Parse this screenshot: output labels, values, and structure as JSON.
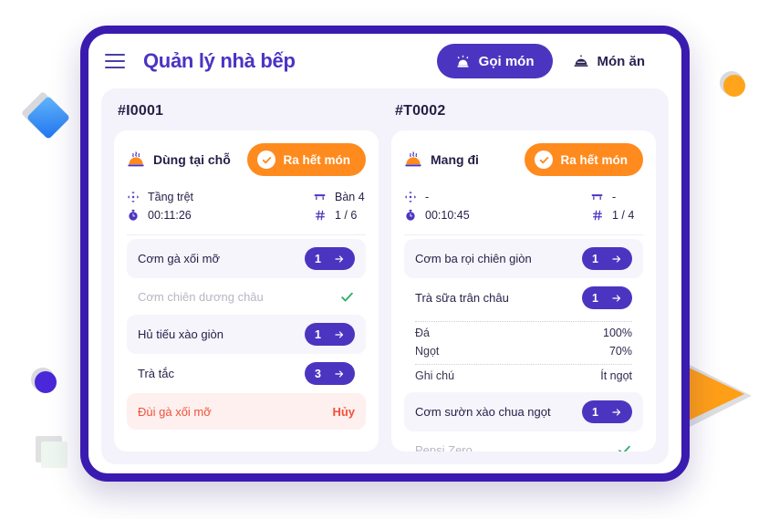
{
  "app": {
    "title": "Quản lý nhà bếp",
    "menu_icon": "hamburger-menu-icon",
    "accent_purple": "#4b35c0",
    "accent_orange": "#ff8a1e",
    "frame_border": "#3a1bb0",
    "panel_bg": "#f4f3fb",
    "danger": "#f1513b",
    "success": "#2fae6a"
  },
  "tabs": [
    {
      "label": "Gọi món",
      "icon": "bell-alarm-icon",
      "active": true
    },
    {
      "label": "Món ăn",
      "icon": "food-cloche-icon",
      "active": false
    }
  ],
  "orders": [
    {
      "code": "#I0001",
      "type_label": "Dùng tại chỗ",
      "type_icon": "dish-steam-icon",
      "done_button": "Ra hết món",
      "done_icon": "check-circle-icon",
      "floor_icon": "floor-move-icon",
      "floor": "Tầng trệt",
      "table_icon": "table-icon",
      "table": "Bàn 4",
      "timer_icon": "stopwatch-icon",
      "timer": "00:11:26",
      "count_icon": "hash-icon",
      "count": "1 / 6",
      "items": [
        {
          "name": "Cơm gà xối mỡ",
          "qty": "1",
          "state": "pending",
          "tinted": true
        },
        {
          "name": "Cơm chiên dương châu",
          "state": "served",
          "tinted": false
        },
        {
          "name": "Hủ tiếu xào giòn",
          "qty": "1",
          "state": "pending",
          "tinted": true
        },
        {
          "name": "Trà tắc",
          "qty": "3",
          "state": "pending",
          "tinted": false
        },
        {
          "name": "Đùi gà xối mỡ",
          "state": "cancelled",
          "cancel_label": "Hủy",
          "tinted": false
        }
      ]
    },
    {
      "code": "#T0002",
      "type_label": "Mang đi",
      "type_icon": "dish-steam-icon",
      "done_button": "Ra hết món",
      "done_icon": "check-circle-icon",
      "floor_icon": "floor-move-icon",
      "floor": "-",
      "table_icon": "table-icon",
      "table": "-",
      "timer_icon": "stopwatch-icon",
      "timer": "00:10:45",
      "count_icon": "hash-icon",
      "count": "1 / 4",
      "items": [
        {
          "name": "Cơm ba rọi chiên giòn",
          "qty": "1",
          "state": "pending",
          "tinted": true
        },
        {
          "name": "Trà sữa trân châu",
          "qty": "1",
          "state": "pending",
          "tinted": false,
          "options": [
            {
              "label": "Đá",
              "value": "100%"
            },
            {
              "label": "Ngọt",
              "value": "70%"
            }
          ],
          "note": {
            "label": "Ghi chú",
            "value": "Ít ngọt"
          }
        },
        {
          "name": "Cơm sườn xào chua ngọt",
          "qty": "1",
          "state": "pending",
          "tinted": true
        },
        {
          "name": "Pepsi Zero",
          "state": "served",
          "tinted": false
        }
      ]
    }
  ],
  "decorations": [
    {
      "name": "blue-diamond",
      "color": "#2f87f2"
    },
    {
      "name": "purple-circle",
      "color": "#4a27d8"
    },
    {
      "name": "green-square",
      "color": "#eef6ef"
    },
    {
      "name": "orange-circle",
      "color": "#ffa41b"
    },
    {
      "name": "orange-triangle",
      "color": "#ff9f18"
    }
  ]
}
